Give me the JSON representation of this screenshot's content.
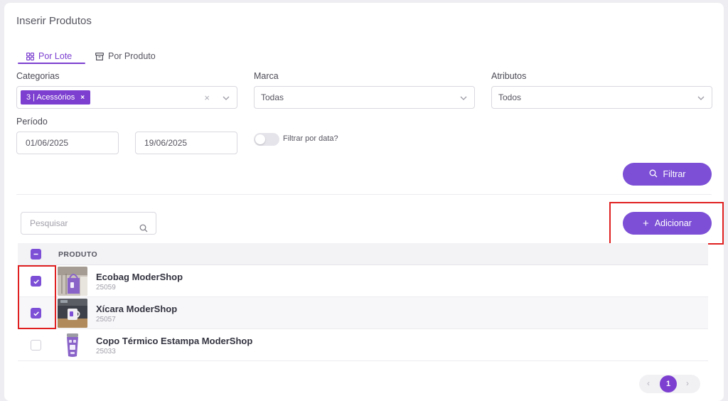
{
  "page": {
    "title": "Inserir Produtos"
  },
  "tabs": [
    {
      "label": "Por Lote",
      "icon": "grid-icon",
      "active": true
    },
    {
      "label": "Por Produto",
      "icon": "archive-box-icon",
      "active": false
    }
  ],
  "filters": {
    "categorias": {
      "label": "Categorias",
      "selected_chip": "3 | Acessórios",
      "chip_remove": "×"
    },
    "marca": {
      "label": "Marca",
      "value": "Todas"
    },
    "atributos": {
      "label": "Atributos",
      "value": "Todos"
    },
    "periodo": {
      "label": "Período",
      "start": "01/06/2025",
      "end": "19/06/2025"
    },
    "date_toggle": {
      "label": "Filtrar por data?",
      "on": false
    },
    "clear_symbol": "×",
    "filter_button": "Filtrar"
  },
  "search": {
    "placeholder": "Pesquisar"
  },
  "add_button": {
    "label": "Adicionar",
    "symbol": "+"
  },
  "table": {
    "header": "PRODUTO",
    "rows": [
      {
        "name": "Ecobag ModerShop",
        "code": "25059",
        "checked": true
      },
      {
        "name": "Xícara ModerShop",
        "code": "25057",
        "checked": true
      },
      {
        "name": "Copo Térmico Estampa ModerShop",
        "code": "25033",
        "checked": false
      }
    ]
  },
  "pagination": {
    "current": "1",
    "prev": "‹",
    "next": "›"
  },
  "colors": {
    "accent": "#7c3fd0",
    "button": "#7c4fd6",
    "highlight": "#e02020"
  }
}
